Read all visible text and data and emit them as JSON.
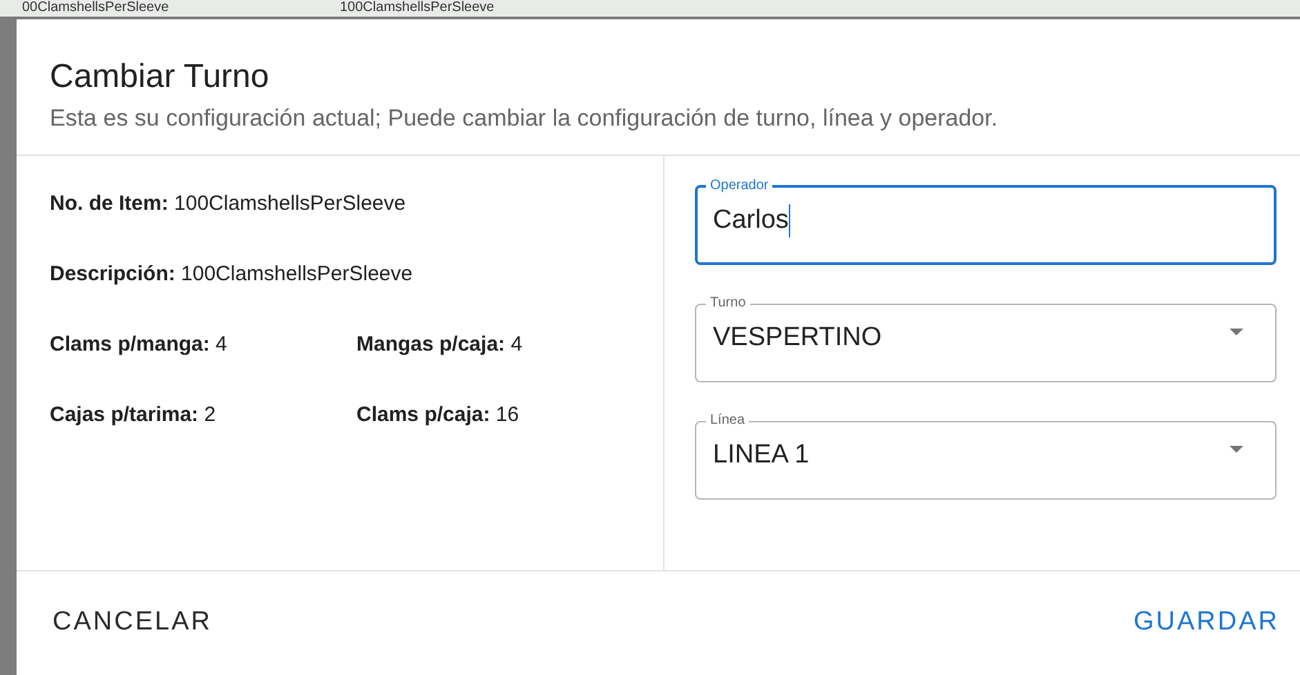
{
  "background": {
    "cells": [
      "00ClamshellsPerSleeve",
      "100ClamshellsPerSleeve"
    ]
  },
  "dialog": {
    "title": "Cambiar Turno",
    "subtitle": "Esta es su configuración actual; Puede cambiar la configuración de turno, línea y operador.",
    "details": [
      {
        "label": "No. de Item:",
        "value": "100ClamshellsPerSleeve",
        "kind": "wide"
      },
      {
        "label": "Descripción:",
        "value": "100ClamshellsPerSleeve",
        "kind": "wide"
      },
      {
        "label": "Clams p/manga:",
        "value": "4",
        "kind": "half"
      },
      {
        "label": "Mangas p/caja:",
        "value": "4",
        "kind": "half"
      },
      {
        "label": "Cajas p/tarima:",
        "value": "2",
        "kind": "half"
      },
      {
        "label": "Clams p/caja:",
        "value": "16",
        "kind": "half"
      }
    ],
    "fields": [
      {
        "kind": "text",
        "label": "Operador",
        "value": "Carlos",
        "focused": true
      },
      {
        "kind": "select",
        "label": "Turno",
        "value": "VESPERTINO",
        "focused": false
      },
      {
        "kind": "select",
        "label": "Línea",
        "value": "LINEA 1",
        "focused": false
      }
    ],
    "actions": [
      {
        "label": "CANCELAR",
        "kind": "secondary"
      },
      {
        "label": "GUARDAR",
        "kind": "primary"
      }
    ]
  }
}
